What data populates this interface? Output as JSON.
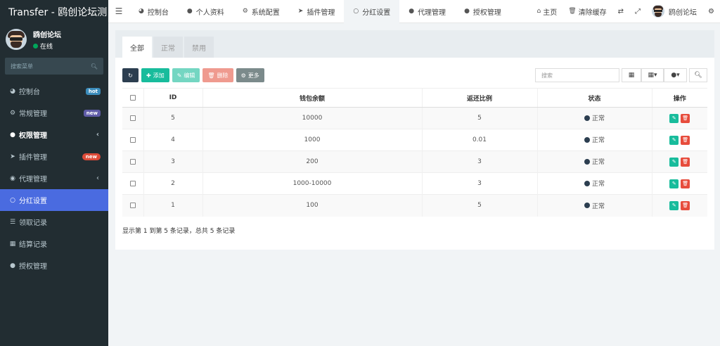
{
  "brand": "Transfer - 鸥创论坛测",
  "user": {
    "name": "鸥创论坛",
    "status": "在线"
  },
  "side_search_placeholder": "搜索菜单",
  "menu": [
    {
      "label": "控制台",
      "icon": "dashboard-icon",
      "badge": "hot"
    },
    {
      "label": "常规管理",
      "icon": "cogs-icon",
      "badge": "new"
    },
    {
      "label": "权限管理",
      "icon": "users-icon",
      "chevron": true
    },
    {
      "label": "插件管理",
      "icon": "rocket-icon",
      "badge": "new"
    },
    {
      "label": "代理管理",
      "icon": "user-circle-icon",
      "chevron": true
    },
    {
      "label": "分红设置",
      "icon": "circle-icon",
      "active": true
    },
    {
      "label": "领取记录",
      "icon": "hand-icon"
    },
    {
      "label": "结算记录",
      "icon": "list-alt-icon"
    },
    {
      "label": "授权管理",
      "icon": "users-icon"
    }
  ],
  "navbar": {
    "tabs": [
      "控制台",
      "个人资料",
      "系统配置",
      "插件管理",
      "分红设置",
      "代理管理",
      "授权管理"
    ],
    "home": "主页",
    "clear_cache": "清除缓存",
    "username": "鸥创论坛"
  },
  "panel_tabs": [
    "全部",
    "正常",
    "禁用"
  ],
  "toolbar": {
    "add": "添加",
    "edit": "编辑",
    "delete": "删除",
    "more": "更多",
    "search_placeholder": "搜索"
  },
  "table": {
    "headers": [
      "ID",
      "钱包余额",
      "返还比例",
      "状态",
      "操作"
    ],
    "rows": [
      {
        "id": "5",
        "balance": "10000",
        "ratio": "5",
        "status": "正常"
      },
      {
        "id": "4",
        "balance": "1000",
        "ratio": "0.01",
        "status": "正常"
      },
      {
        "id": "3",
        "balance": "200",
        "ratio": "3",
        "status": "正常"
      },
      {
        "id": "2",
        "balance": "1000-10000",
        "ratio": "3",
        "status": "正常"
      },
      {
        "id": "1",
        "balance": "100",
        "ratio": "5",
        "status": "正常"
      }
    ]
  },
  "pagination_info": "显示第 1 到第 5 条记录，总共 5 条记录"
}
